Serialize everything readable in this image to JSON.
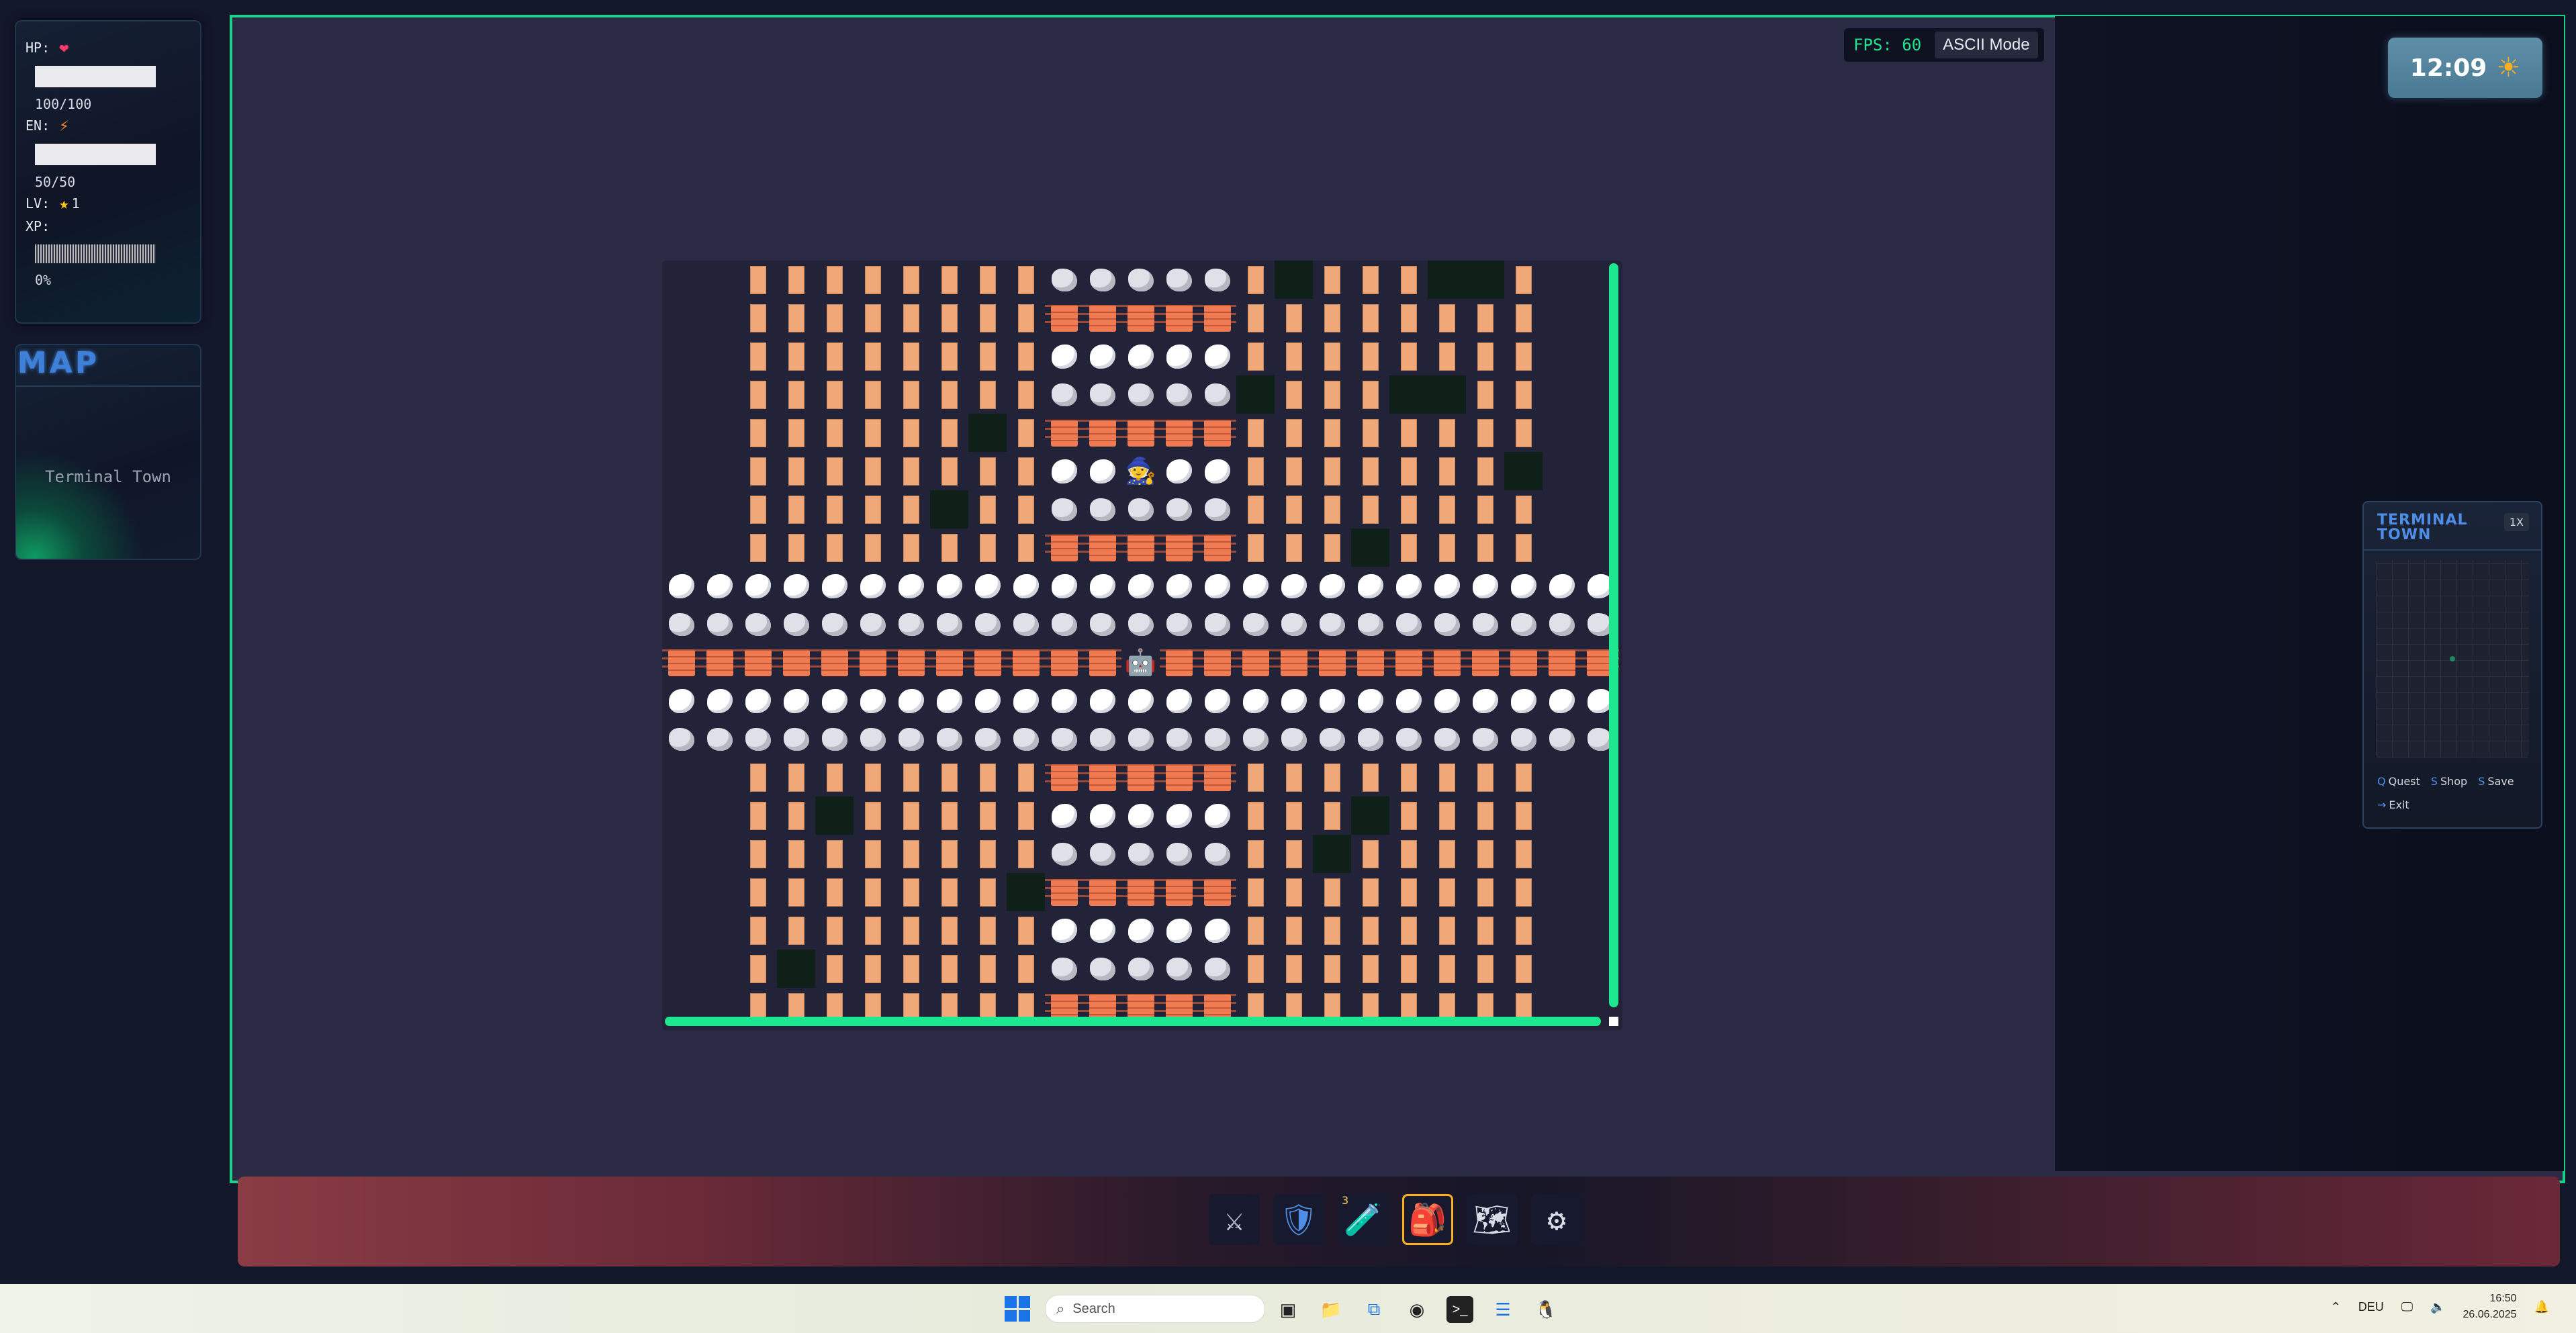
{
  "stats": {
    "hp_label": "HP:",
    "hp_icon": "heart-icon",
    "hp_value": "100/100",
    "en_label": "EN:",
    "en_icon": "lightning-icon",
    "en_value": "50/50",
    "lv_label": "LV:",
    "lv_icon": "star-icon",
    "lv_value": "1",
    "xp_label": "XP:",
    "xp_value": "0%",
    "hp_fraction": 1.0,
    "en_fraction": 1.0,
    "xp_fraction": 0.0
  },
  "map_card": {
    "title": "MAP",
    "location": "Terminal Town"
  },
  "hud": {
    "fps": "FPS: 60",
    "mode_button": "ASCII Mode"
  },
  "clock": {
    "time": "12:09",
    "weather_icon": "sun-icon"
  },
  "minimap": {
    "title": "TERMINAL TOWN",
    "zoom": "1X",
    "actions": [
      {
        "key": "Q",
        "label": "Quest"
      },
      {
        "key": "S",
        "label": "Shop"
      },
      {
        "key": "S",
        "label": "Save"
      },
      {
        "key": "",
        "label": "Exit"
      }
    ]
  },
  "hotbar": {
    "slots": [
      {
        "icon": "swords-icon",
        "count": ""
      },
      {
        "icon": "shield-icon",
        "count": ""
      },
      {
        "icon": "potion-icon",
        "count": "3"
      },
      {
        "icon": "backpack-icon",
        "count": "",
        "active": true
      },
      {
        "icon": "map-icon",
        "count": ""
      },
      {
        "icon": "gear-icon",
        "count": ""
      }
    ]
  },
  "taskbar": {
    "search_placeholder": "Search",
    "language": "DEU",
    "time": "16:50",
    "date": "26.06.2025"
  },
  "colors": {
    "accent_green": "#1ee88f",
    "accent_blue": "#4f8ee6",
    "highlight_gold": "#ffb020"
  }
}
